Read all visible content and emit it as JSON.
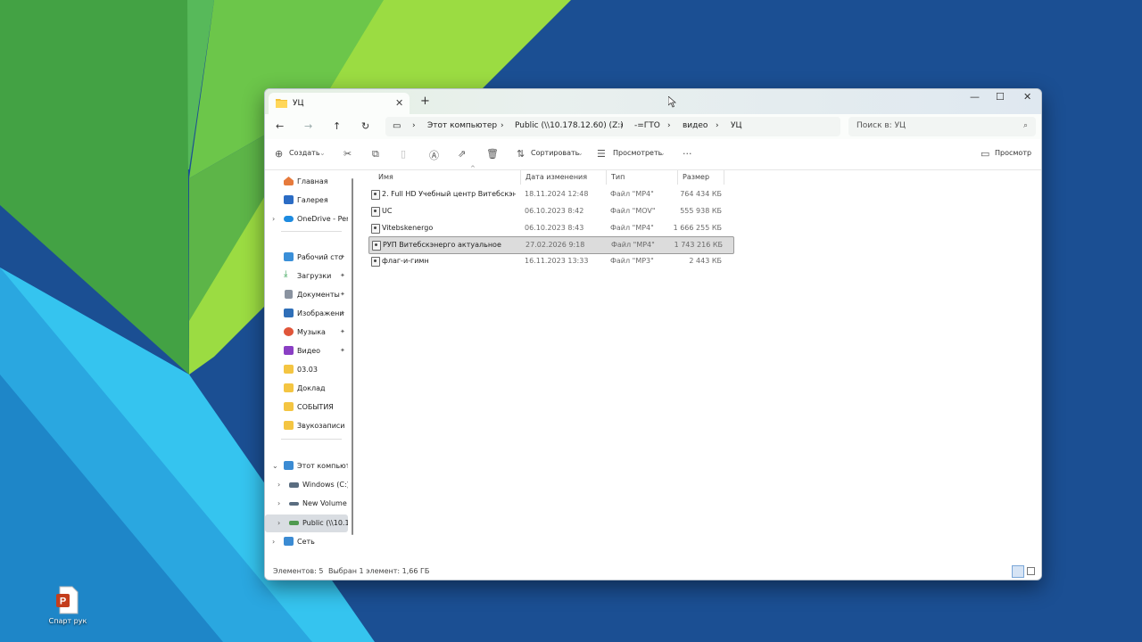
{
  "desktop": {
    "icon_label": "Спарт рук"
  },
  "window": {
    "tab_title": "УЦ",
    "colors": {
      "selection": "#dcdcdc",
      "accent": "#1a73e8"
    }
  },
  "address": {
    "segments": [
      "Этот компьютер",
      "Public (\\\\10.178.12.60) (Z:)",
      "-=ГТО",
      "видео",
      "УЦ"
    ]
  },
  "search": {
    "placeholder": "Поиск в: УЦ"
  },
  "toolbar": {
    "new_label": "Создать",
    "sort_label": "Сортировать",
    "view_label": "Просмотреть",
    "preview_label": "Просмотр"
  },
  "nav": {
    "items": [
      {
        "label": "Главная",
        "icon": "home-icon"
      },
      {
        "label": "Галерея",
        "icon": "gallery-icon"
      },
      {
        "label": "OneDrive - Perso",
        "icon": "cloud-icon"
      },
      {
        "label": "Рабочий сто",
        "icon": "desktop-icon"
      },
      {
        "label": "Загрузки",
        "icon": "download-icon"
      },
      {
        "label": "Документы",
        "icon": "documents-icon"
      },
      {
        "label": "Изображени",
        "icon": "pictures-icon"
      },
      {
        "label": "Музыка",
        "icon": "music-icon"
      },
      {
        "label": "Видео",
        "icon": "video-icon"
      },
      {
        "label": "03.03",
        "icon": "folder-icon"
      },
      {
        "label": "Доклад",
        "icon": "folder-icon"
      },
      {
        "label": "СОБЫТИЯ",
        "icon": "folder-icon"
      },
      {
        "label": "Звукозаписи",
        "icon": "folder-icon"
      },
      {
        "label": "Этот компьюте",
        "icon": "computer-icon"
      },
      {
        "label": "Windows (C:)",
        "icon": "drive-icon"
      },
      {
        "label": "New Volume (",
        "icon": "drive-icon"
      },
      {
        "label": "Public (\\\\10.17",
        "icon": "network-drive-icon"
      },
      {
        "label": "Сеть",
        "icon": "network-icon"
      }
    ]
  },
  "columns": {
    "name": "Имя",
    "date": "Дата изменения",
    "type": "Тип",
    "size": "Размер"
  },
  "files": [
    {
      "name": "2.  Full HD Учебный центр Витебскэнер...",
      "date": "18.11.2024 12:48",
      "type": "Файл \"MP4\"",
      "size": "764 434 КБ"
    },
    {
      "name": "UC",
      "date": "06.10.2023 8:42",
      "type": "Файл \"MOV\"",
      "size": "555 938 КБ"
    },
    {
      "name": "Vitebskenergo",
      "date": "06.10.2023 8:43",
      "type": "Файл \"MP4\"",
      "size": "1 666 255 КБ"
    },
    {
      "name": "РУП Витебскэнерго актуальное",
      "date": "27.02.2026 9:18",
      "type": "Файл \"MP4\"",
      "size": "1 743 216 КБ"
    },
    {
      "name": "флаг-и-гимн",
      "date": "16.11.2023 13:33",
      "type": "Файл \"MP3\"",
      "size": "2 443 КБ"
    }
  ],
  "status": {
    "count": "Элементов: 5",
    "selected": "Выбран 1 элемент: 1,66 ГБ"
  }
}
